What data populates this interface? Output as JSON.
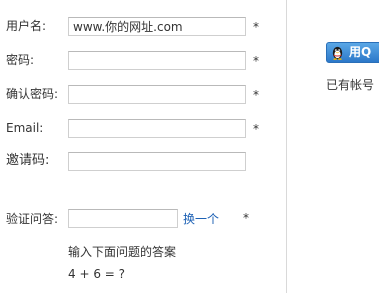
{
  "form": {
    "username": {
      "label": "用户名:",
      "value": "www.你的网址.com",
      "required_mark": "*"
    },
    "password": {
      "label": "密码:",
      "value": "",
      "required_mark": "*"
    },
    "confirm_password": {
      "label": "确认密码:",
      "value": "",
      "required_mark": "*"
    },
    "email": {
      "label": "Email:",
      "value": "",
      "required_mark": "*"
    },
    "invite_code": {
      "label": "邀请码:",
      "value": ""
    },
    "verify_answer": {
      "label": "验证问答:",
      "value": "",
      "refresh_link": "换一个",
      "required_mark": "*",
      "hint": "输入下面问题的答案",
      "question": "4 + 6 = ?"
    }
  },
  "side": {
    "qq_login_label": "用Q",
    "account_text": "已有帐号"
  },
  "colors": {
    "link": "#1a5fb4",
    "qq_button": "#3a8ad6",
    "field_border": "#cfcfcf"
  }
}
